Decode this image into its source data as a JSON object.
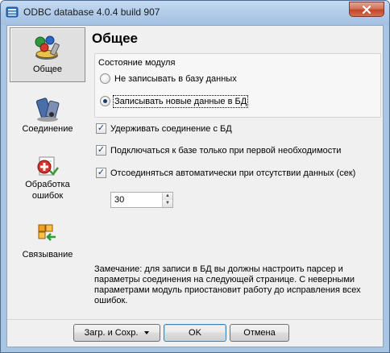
{
  "window": {
    "title": "ODBC database 4.0.4 build 907",
    "close_glyph": "✕"
  },
  "sidebar": {
    "items": [
      {
        "label": "Общее",
        "icon": "general-icon",
        "active": true
      },
      {
        "label": "Соединение",
        "icon": "connection-icon",
        "active": false
      },
      {
        "label": "Обработка ошибок",
        "icon": "error-handling-icon",
        "active": false
      },
      {
        "label": "Связывание",
        "icon": "binding-icon",
        "active": false
      }
    ]
  },
  "main": {
    "title": "Общее",
    "module_state": {
      "caption": "Состояние модуля",
      "options": [
        {
          "label": "Не записывать в базу данных",
          "selected": false
        },
        {
          "label": "Записывать новые данные в БД",
          "selected": true
        }
      ]
    },
    "checkboxes": [
      {
        "label": "Удерживать соединение с БД",
        "checked": true
      },
      {
        "label": "Подключаться к базе только при первой необходимости",
        "checked": true
      },
      {
        "label": "Отсоединяться автоматически при отсутствии данных (сек)",
        "checked": true
      }
    ],
    "timeout_value": "30",
    "note": "Замечание: для записи в БД вы должны настроить парсер и параметры соединения на следующей странице. С неверными параметрами модуль приостановит работу до исправления всех ошибок."
  },
  "buttons": {
    "load_save": "Загр. и Сохр.",
    "ok": "OK",
    "cancel": "Отмена"
  },
  "colors": {
    "frame": "#a9c5e4",
    "close_button": "#c4452a",
    "client_bg": "#f0f0f0"
  }
}
